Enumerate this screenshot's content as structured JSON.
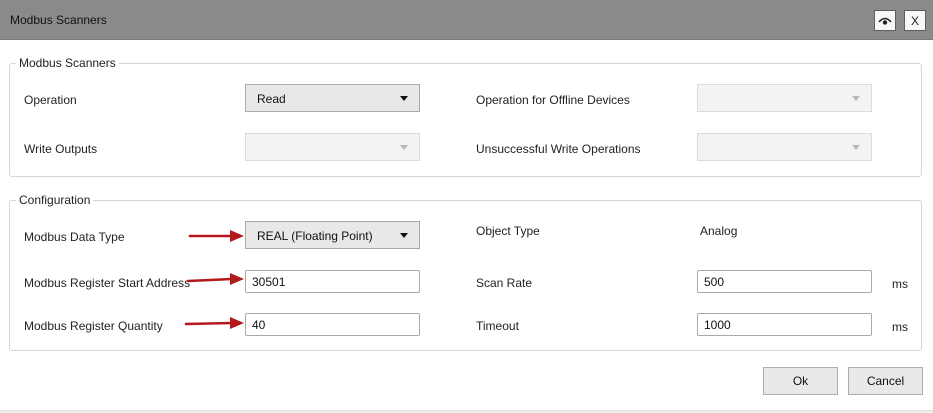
{
  "window": {
    "title": "Modbus Scanners",
    "close_label": "X",
    "eye_icon": "eye-icon"
  },
  "scanners": {
    "legend": "Modbus Scanners",
    "operation_label": "Operation",
    "operation_value": "Read",
    "offline_label": "Operation for Offline Devices",
    "offline_value": "",
    "write_outputs_label": "Write Outputs",
    "write_outputs_value": "",
    "unsuccessful_label": "Unsuccessful Write Operations",
    "unsuccessful_value": ""
  },
  "config": {
    "legend": "Configuration",
    "data_type_label": "Modbus Data Type",
    "data_type_value": "REAL (Floating Point)",
    "start_address_label": "Modbus Register Start Address",
    "start_address_value": "30501",
    "quantity_label": "Modbus Register Quantity",
    "quantity_value": "40",
    "object_type_label": "Object Type",
    "object_type_value": "Analog",
    "scan_rate_label": "Scan Rate",
    "scan_rate_value": "500",
    "scan_rate_unit": "ms",
    "timeout_label": "Timeout",
    "timeout_value": "1000",
    "timeout_unit": "ms"
  },
  "buttons": {
    "ok": "Ok",
    "cancel": "Cancel"
  },
  "colors": {
    "annotation_arrow": "#b3191c",
    "titlebar": "#8a8a8a"
  }
}
